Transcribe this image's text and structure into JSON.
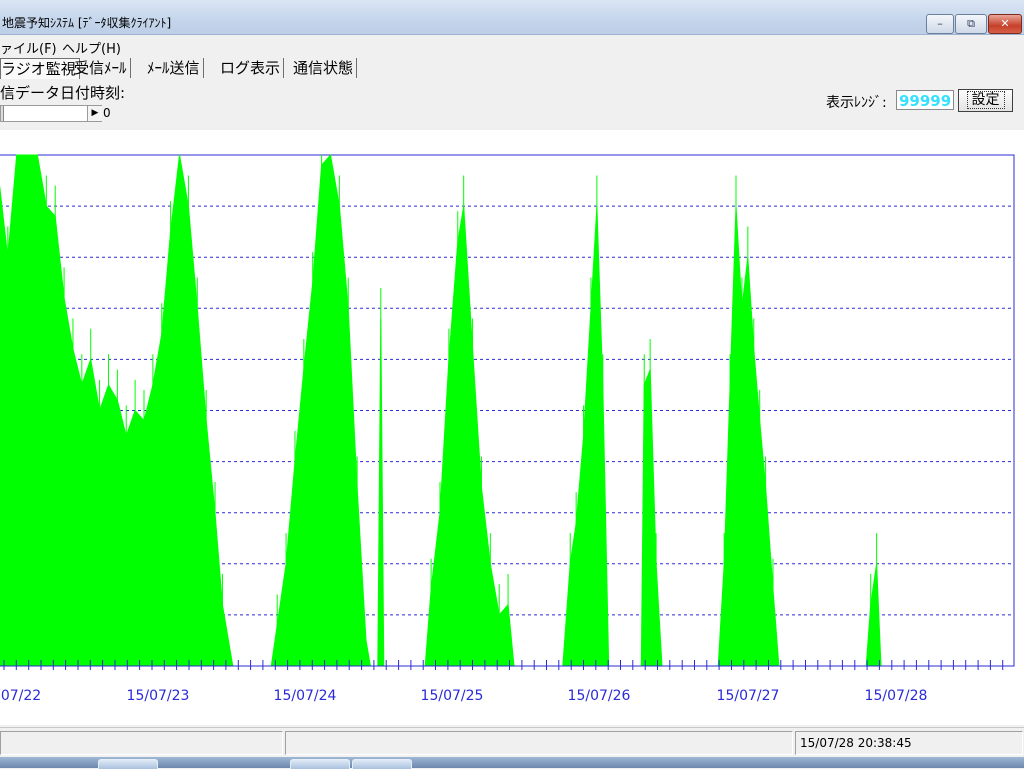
{
  "window": {
    "title": "地震予知ｼｽﾃﾑ [ﾃﾞｰﾀ収集ｸﾗｲｱﾝﾄ]"
  },
  "menu": {
    "items": [
      "ァイル(F)",
      "ヘルプ(H)"
    ]
  },
  "tabs": [
    "ラジオ監視",
    "受信ﾒｰﾙ",
    "ﾒｰﾙ送信",
    "ログ表示",
    "通信状態"
  ],
  "panel": {
    "date_label": "信データ日付時刻:",
    "scroll_value": "0",
    "range_label": "表示ﾚﾝｼﾞ:",
    "range_value": "99999",
    "set_button": "設定"
  },
  "status": {
    "timestamp": "15/07/28 20:38:45"
  },
  "colors": {
    "signal": "#00ff00",
    "grid": "#2b2bd6",
    "range_text": "#36e0ff"
  },
  "chart_data": {
    "type": "area",
    "title": "",
    "xlabel": "",
    "ylabel": "",
    "ylim": [
      0,
      99999
    ],
    "grid": "horizontal-dashed",
    "x_tick_labels": [
      "07/22",
      "15/07/23",
      "15/07/24",
      "15/07/25",
      "15/07/26",
      "15/07/27",
      "15/07/28"
    ],
    "series": [
      {
        "values": [
          [
            0,
            0.5
          ],
          [
            0.05,
            0.7
          ],
          [
            0.12,
            0.62
          ],
          [
            0.18,
            0.55
          ],
          [
            0.25,
            0.75
          ],
          [
            0.32,
            0.65
          ],
          [
            0.4,
            0.85
          ],
          [
            0.46,
            0.7
          ],
          [
            0.52,
            0.95
          ],
          [
            0.58,
            0.8
          ],
          [
            0.64,
            1.0
          ],
          [
            0.7,
            1.0
          ],
          [
            0.78,
            1.0
          ],
          [
            0.84,
            0.9
          ],
          [
            0.9,
            0.88
          ],
          [
            0.96,
            0.72
          ],
          [
            1.02,
            0.62
          ],
          [
            1.08,
            0.55
          ],
          [
            1.14,
            0.6
          ],
          [
            1.2,
            0.5
          ],
          [
            1.26,
            0.55
          ],
          [
            1.32,
            0.52
          ],
          [
            1.38,
            0.45
          ],
          [
            1.44,
            0.5
          ],
          [
            1.5,
            0.48
          ],
          [
            1.56,
            0.55
          ],
          [
            1.62,
            0.65
          ],
          [
            1.68,
            0.85
          ],
          [
            1.74,
            1.0
          ],
          [
            1.8,
            0.9
          ],
          [
            1.86,
            0.7
          ],
          [
            1.92,
            0.48
          ],
          [
            1.98,
            0.3
          ],
          [
            2.03,
            0.12
          ],
          [
            2.1,
            0.0
          ],
          [
            2.36,
            0.0
          ],
          [
            2.4,
            0.08
          ],
          [
            2.46,
            0.2
          ],
          [
            2.52,
            0.4
          ],
          [
            2.58,
            0.58
          ],
          [
            2.64,
            0.75
          ],
          [
            2.7,
            0.98
          ],
          [
            2.76,
            1.0
          ],
          [
            2.82,
            0.9
          ],
          [
            2.88,
            0.7
          ],
          [
            2.94,
            0.35
          ],
          [
            3.0,
            0.05
          ],
          [
            3.03,
            0.0
          ],
          [
            3.08,
            0.0
          ],
          [
            3.1,
            0.68
          ],
          [
            3.12,
            0.0
          ],
          [
            3.4,
            0.0
          ],
          [
            3.44,
            0.15
          ],
          [
            3.5,
            0.3
          ],
          [
            3.56,
            0.6
          ],
          [
            3.62,
            0.83
          ],
          [
            3.66,
            0.9
          ],
          [
            3.72,
            0.62
          ],
          [
            3.78,
            0.35
          ],
          [
            3.84,
            0.2
          ],
          [
            3.9,
            0.1
          ],
          [
            3.96,
            0.12
          ],
          [
            4.0,
            0.0
          ],
          [
            4.33,
            0.0
          ],
          [
            4.38,
            0.2
          ],
          [
            4.42,
            0.28
          ],
          [
            4.47,
            0.45
          ],
          [
            4.52,
            0.7
          ],
          [
            4.56,
            0.9
          ],
          [
            4.6,
            0.55
          ],
          [
            4.64,
            0.0
          ],
          [
            4.86,
            0.0
          ],
          [
            4.88,
            0.55
          ],
          [
            4.92,
            0.58
          ],
          [
            4.96,
            0.2
          ],
          [
            5.0,
            0.0
          ],
          [
            5.38,
            0.0
          ],
          [
            5.42,
            0.2
          ],
          [
            5.46,
            0.55
          ],
          [
            5.5,
            0.9
          ],
          [
            5.54,
            0.7
          ],
          [
            5.58,
            0.8
          ],
          [
            5.62,
            0.62
          ],
          [
            5.66,
            0.48
          ],
          [
            5.7,
            0.35
          ],
          [
            5.75,
            0.15
          ],
          [
            5.79,
            0.0
          ],
          [
            6.38,
            0.0
          ],
          [
            6.41,
            0.12
          ],
          [
            6.45,
            0.2
          ],
          [
            6.48,
            0.0
          ]
        ]
      }
    ]
  }
}
